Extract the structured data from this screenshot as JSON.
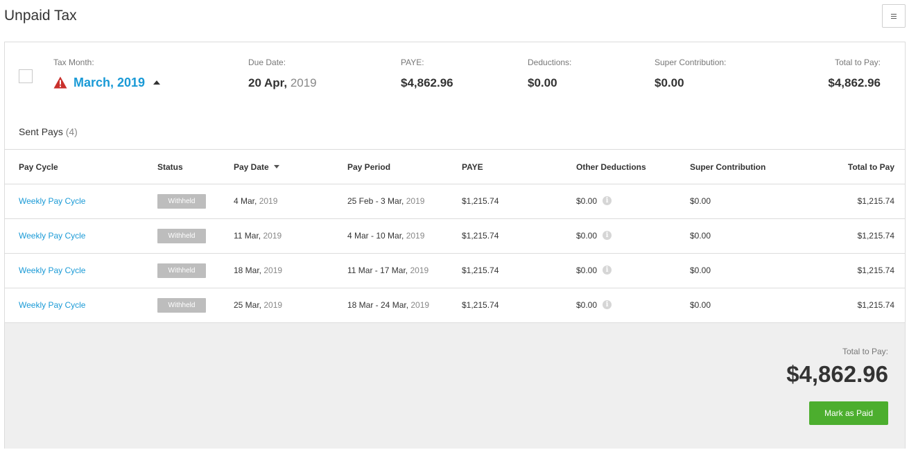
{
  "page": {
    "title": "Unpaid Tax"
  },
  "summary": {
    "tax_month_label": "Tax Month:",
    "tax_month_value": "March, 2019",
    "due_date_label": "Due Date:",
    "due_date_day": "20 Apr,",
    "due_date_year": "2019",
    "paye_label": "PAYE:",
    "paye_value": "$4,862.96",
    "deductions_label": "Deductions:",
    "deductions_value": "$0.00",
    "super_label": "Super Contribution:",
    "super_value": "$0.00",
    "total_label": "Total to Pay:",
    "total_value": "$4,862.96",
    "warning_color": "#c9302c"
  },
  "sent_pays": {
    "label": "Sent Pays",
    "count": "(4)"
  },
  "table": {
    "headers": {
      "pay_cycle": "Pay Cycle",
      "status": "Status",
      "pay_date": "Pay Date",
      "pay_period": "Pay Period",
      "paye": "PAYE",
      "other_deductions": "Other Deductions",
      "super_contribution": "Super Contribution",
      "total_to_pay": "Total to Pay"
    },
    "rows": [
      {
        "pay_cycle": "Weekly Pay Cycle",
        "status": "Withheld",
        "pay_date_day": "4 Mar,",
        "pay_date_year": "2019",
        "period_range": "25 Feb - 3 Mar,",
        "period_year": "2019",
        "paye": "$1,215.74",
        "other_deductions": "$0.00",
        "super": "$0.00",
        "total": "$1,215.74"
      },
      {
        "pay_cycle": "Weekly Pay Cycle",
        "status": "Withheld",
        "pay_date_day": "11 Mar,",
        "pay_date_year": "2019",
        "period_range": "4 Mar - 10 Mar,",
        "period_year": "2019",
        "paye": "$1,215.74",
        "other_deductions": "$0.00",
        "super": "$0.00",
        "total": "$1,215.74"
      },
      {
        "pay_cycle": "Weekly Pay Cycle",
        "status": "Withheld",
        "pay_date_day": "18 Mar,",
        "pay_date_year": "2019",
        "period_range": "11 Mar - 17 Mar,",
        "period_year": "2019",
        "paye": "$1,215.74",
        "other_deductions": "$0.00",
        "super": "$0.00",
        "total": "$1,215.74"
      },
      {
        "pay_cycle": "Weekly Pay Cycle",
        "status": "Withheld",
        "pay_date_day": "25 Mar,",
        "pay_date_year": "2019",
        "period_range": "18 Mar - 24 Mar,",
        "period_year": "2019",
        "paye": "$1,215.74",
        "other_deductions": "$0.00",
        "super": "$0.00",
        "total": "$1,215.74"
      }
    ]
  },
  "footer": {
    "total_label": "Total to Pay:",
    "total_value": "$4,862.96",
    "mark_paid_label": "Mark as Paid",
    "button_color": "#4cae2e"
  },
  "colors": {
    "link": "#1a9ad6",
    "badge": "#bdbdbd"
  },
  "icons": {
    "menu": "menu-icon",
    "warning": "warning-icon",
    "sort": "sort-down-icon",
    "info": "info-icon",
    "expand": "caret-up-icon"
  }
}
